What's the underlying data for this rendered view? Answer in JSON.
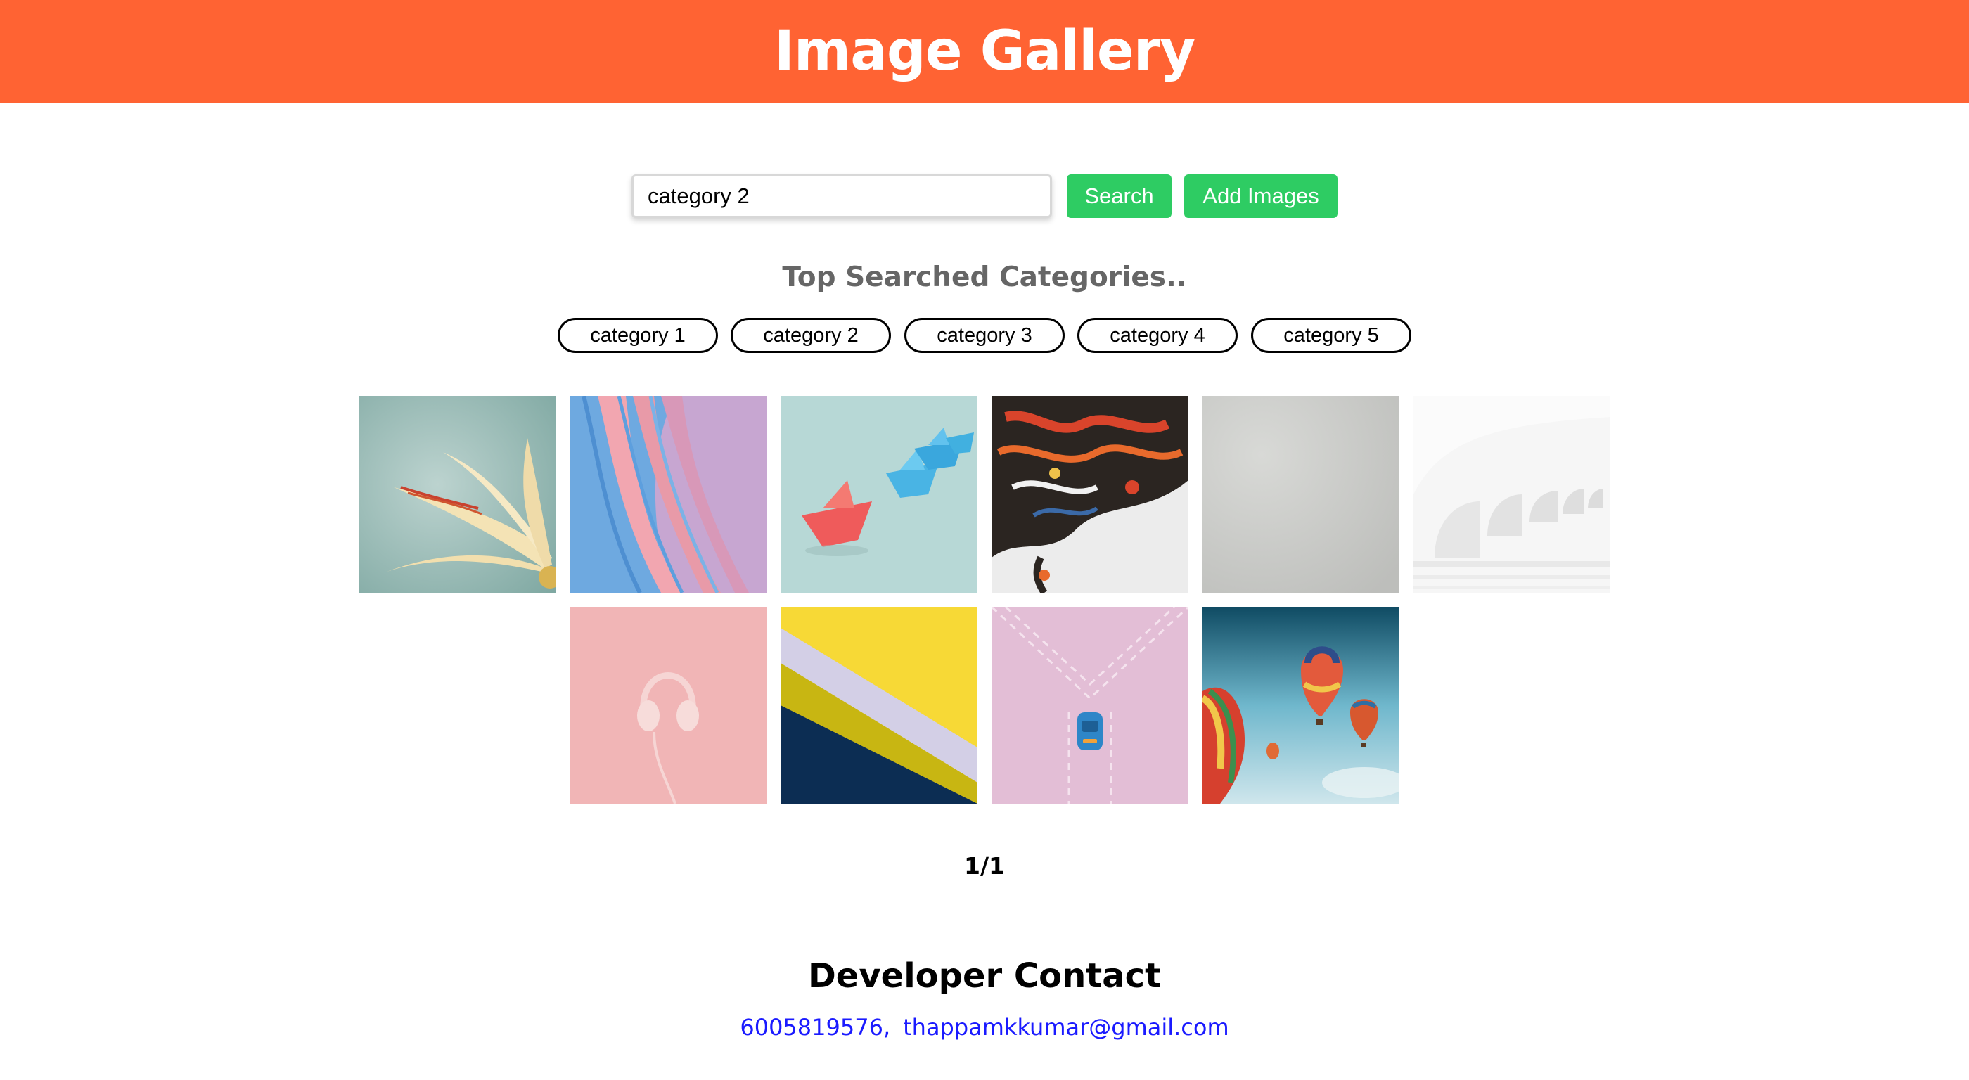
{
  "header": {
    "title": "Image Gallery",
    "color": "#ff6333"
  },
  "search": {
    "value": "category 2",
    "search_label": "Search",
    "add_label": "Add Images",
    "button_color": "#2ecc63"
  },
  "top_categories": {
    "heading": "Top Searched Categories..",
    "items": [
      "category 1",
      "category 2",
      "category 3",
      "category 4",
      "category 5"
    ]
  },
  "gallery": {
    "images": [
      "yellow-flower-image",
      "pastel-wave-sculpture-image",
      "paper-boats-image",
      "fluid-paint-art-image",
      "grey-wall-texture-image",
      "white-arches-image",
      "pink-headphones-image",
      "geometric-stripes-image",
      "toy-car-on-pink-image",
      "hot-air-balloons-image"
    ]
  },
  "pagination": {
    "text": "1/1"
  },
  "footer": {
    "title": "Developer Contact",
    "phone": "6005819576,",
    "email": "thappamkkumar@gmail.com",
    "link_color": "#1a1aff"
  }
}
